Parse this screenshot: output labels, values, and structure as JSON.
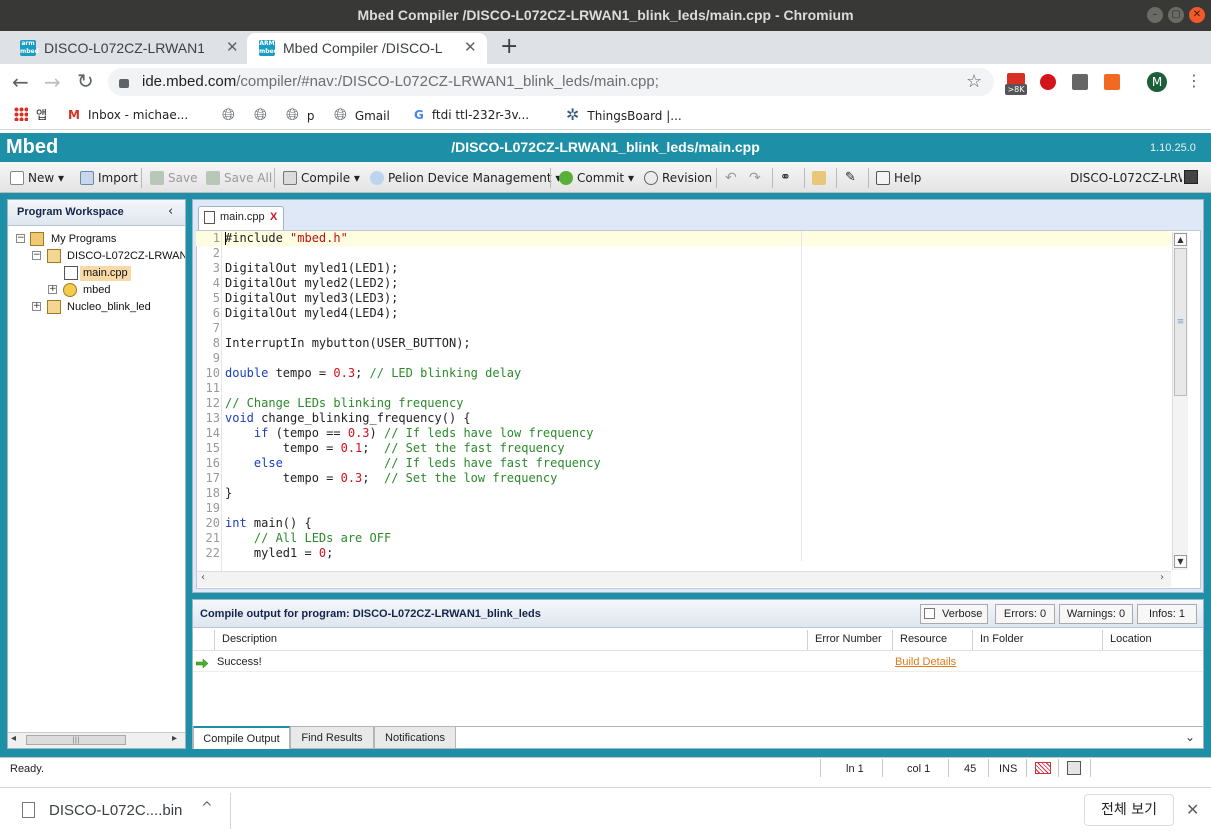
{
  "window": {
    "title": "Mbed Compiler /DISCO-L072CZ-LRWAN1_blink_leds/main.cpp - Chromium"
  },
  "tabs": [
    {
      "label": "DISCO-L072CZ-LRWAN1 | ",
      "favicon": "arm-mbed"
    },
    {
      "label": "Mbed Compiler /DISCO-L",
      "favicon": "arm-mbed"
    }
  ],
  "address": {
    "host": "ide.mbed.com",
    "path": "/compiler/#nav:/DISCO-L072CZ-LRWAN1_blink_leds/main.cpp;"
  },
  "extensions": {
    "gmail_badge": ">8K",
    "avatar_letter": "M"
  },
  "bookmarks": [
    {
      "label": "앱",
      "icon": "apps-grid-icon"
    },
    {
      "label": "Inbox - michae...",
      "icon": "gmail-icon"
    },
    {
      "label": "",
      "icon": "globe-icon"
    },
    {
      "label": "",
      "icon": "globe-icon"
    },
    {
      "label": "p",
      "icon": "globe-icon"
    },
    {
      "label": "Gmail",
      "icon": "globe-icon"
    },
    {
      "label": "ftdi ttl-232r-3v...",
      "icon": "google-icon"
    },
    {
      "label": "ThingsBoard |...",
      "icon": "thingsboard-icon"
    }
  ],
  "mbed": {
    "logo": "Mbed",
    "path": "/DISCO-L072CZ-LRWAN1_blink_leds/main.cpp",
    "version": "1.10.25.0"
  },
  "toolbar": {
    "new": "New",
    "import": "Import",
    "save": "Save",
    "save_all": "Save All",
    "compile": "Compile",
    "pelion": "Pelion Device Management",
    "commit": "Commit",
    "revision": "Revision",
    "help": "Help",
    "target": "DISCO-L072CZ-LRWA"
  },
  "workspace": {
    "title": "Program Workspace",
    "tree": {
      "root": "My Programs",
      "program": "DISCO-L072CZ-LRWAN",
      "file": "main.cpp",
      "lib": "mbed",
      "other": "Nucleo_blink_led"
    }
  },
  "editor": {
    "tab": "main.cpp",
    "tab_close": "X",
    "lines": [
      [
        [
          "pp",
          "#include "
        ],
        [
          "str",
          "\"mbed.h\""
        ]
      ],
      [],
      [
        [
          "t",
          "DigitalOut myled1(LED1);"
        ]
      ],
      [
        [
          "t",
          "DigitalOut myled2(LED2);"
        ]
      ],
      [
        [
          "t",
          "DigitalOut myled3(LED3);"
        ]
      ],
      [
        [
          "t",
          "DigitalOut myled4(LED4);"
        ]
      ],
      [],
      [
        [
          "t",
          "InterruptIn mybutton(USER_BUTTON);"
        ]
      ],
      [],
      [
        [
          "kw",
          "double"
        ],
        [
          "t",
          " tempo = "
        ],
        [
          "num",
          "0.3"
        ],
        [
          "t",
          "; "
        ],
        [
          "cm",
          "// LED blinking delay"
        ]
      ],
      [],
      [
        [
          "cm",
          "// Change LEDs blinking frequency"
        ]
      ],
      [
        [
          "kw",
          "void"
        ],
        [
          "t",
          " change_blinking_frequency() {"
        ]
      ],
      [
        [
          "t",
          "    "
        ],
        [
          "kw",
          "if"
        ],
        [
          "t",
          " (tempo == "
        ],
        [
          "num",
          "0.3"
        ],
        [
          "t",
          ") "
        ],
        [
          "cm",
          "// If leds have low frequency"
        ]
      ],
      [
        [
          "t",
          "        tempo = "
        ],
        [
          "num",
          "0.1"
        ],
        [
          "t",
          ";  "
        ],
        [
          "cm",
          "// Set the fast frequency"
        ]
      ],
      [
        [
          "t",
          "    "
        ],
        [
          "kw",
          "else"
        ],
        [
          "t",
          "              "
        ],
        [
          "cm",
          "// If leds have fast frequency"
        ]
      ],
      [
        [
          "t",
          "        tempo = "
        ],
        [
          "num",
          "0.3"
        ],
        [
          "t",
          ";  "
        ],
        [
          "cm",
          "// Set the low frequency"
        ]
      ],
      [
        [
          "t",
          "}"
        ]
      ],
      [],
      [
        [
          "kw",
          "int"
        ],
        [
          "t",
          " main() {"
        ]
      ],
      [
        [
          "t",
          "    "
        ],
        [
          "cm",
          "// All LEDs are OFF"
        ]
      ],
      [
        [
          "t",
          "    myled1 = "
        ],
        [
          "num",
          "0"
        ],
        [
          "t",
          ";"
        ]
      ]
    ]
  },
  "output": {
    "title": "Compile output for program: DISCO-L072CZ-LRWAN1_blink_leds",
    "verbose": "Verbose",
    "errors": "Errors: 0",
    "warnings": "Warnings: 0",
    "infos": "Infos: 1",
    "columns": [
      "Description",
      "Error Number",
      "Resource",
      "In Folder",
      "Location"
    ],
    "rows": [
      {
        "description": "Success!",
        "error_number": "",
        "resource": "Build Details",
        "folder": "",
        "location": ""
      }
    ],
    "tabs": [
      "Compile Output",
      "Find Results",
      "Notifications"
    ]
  },
  "status": {
    "text": "Ready.",
    "line": "ln 1",
    "col": "col 1",
    "pos": "45",
    "mode": "INS"
  },
  "download": {
    "file": "DISCO-L072C....bin",
    "show_all": "전체 보기"
  },
  "colors": {
    "mbed_teal": "#1d8fa6",
    "tab_active": "#ffffff",
    "comment": "#2b8a2b",
    "keyword": "#1a3fc0",
    "number": "#d0111e"
  }
}
